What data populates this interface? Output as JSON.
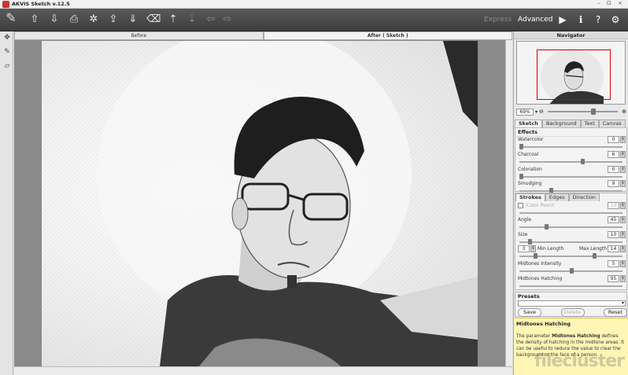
{
  "window": {
    "title": "AKVIS Sketch v.12.5",
    "controls": "– ⊡ ×"
  },
  "toolbar": {
    "modes": {
      "express": "Express",
      "advanced": "Advanced"
    }
  },
  "canvas_tabs": {
    "before": "Before",
    "after": "After ( Sketch )"
  },
  "navigator": {
    "title": "Navigator",
    "zoom": "69%"
  },
  "panel_tabs": [
    "Sketch",
    "Background",
    "Text",
    "Canvas"
  ],
  "effects": {
    "title": "Effects",
    "params": [
      {
        "label": "Watercolor",
        "value": "0",
        "pos": 0.0
      },
      {
        "label": "Charcoal",
        "value": "6",
        "pos": 0.6
      },
      {
        "label": "Coloration",
        "value": "0",
        "pos": 0.0
      },
      {
        "label": "Smudging",
        "value": "9",
        "pos": 0.3
      }
    ]
  },
  "strokes": {
    "tabs": [
      "Strokes",
      "Edges",
      "Direction"
    ],
    "color_pencil": {
      "label": "Color Pencil",
      "value": "10"
    },
    "angle": {
      "label": "Angle",
      "value": "45",
      "pos": 0.25
    },
    "size": {
      "label": "Size",
      "value": "10",
      "pos": 0.1
    },
    "min_length": {
      "label": "Min Length",
      "value": "3"
    },
    "max_length": {
      "label": "Max Length",
      "value": "14"
    },
    "midtones_intensity": {
      "label": "Midtones Intensity",
      "value": "5",
      "pos": 0.5
    },
    "midtones_hatching": {
      "label": "Midtones Hatching",
      "value": "95",
      "pos": 0.95
    }
  },
  "presets": {
    "title": "Presets",
    "save": "Save",
    "delete": "Delete",
    "reset": "Reset"
  },
  "help": {
    "title": "Midtones Hatching",
    "text_a": "The parameter ",
    "text_b": "Midtones Hatching",
    "text_c": " defines the density of hatching in the midtone areas. It can be useful to reduce the value to clear the background or the face of a person.",
    "watermark": "filecluster"
  }
}
